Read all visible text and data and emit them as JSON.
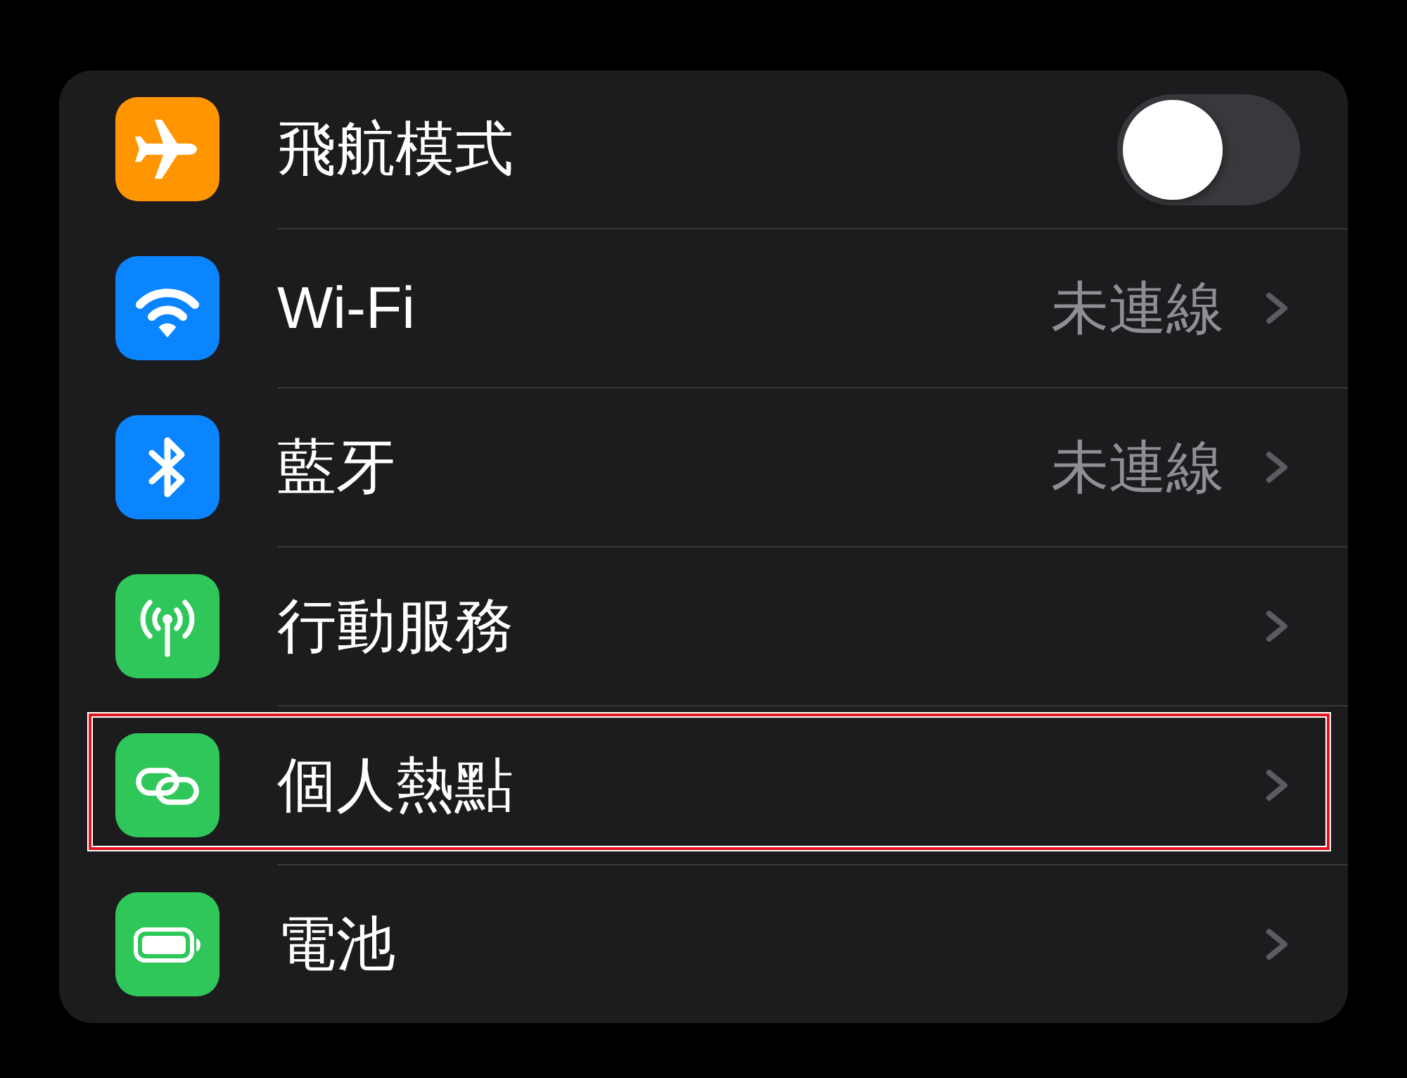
{
  "rows": [
    {
      "label": "飛航模式",
      "kind": "toggle",
      "on": false,
      "color": "#ff9500",
      "highlighted": false
    },
    {
      "label": "Wi-Fi",
      "kind": "link",
      "value": "未連線",
      "color": "#0a84ff",
      "highlighted": false
    },
    {
      "label": "藍牙",
      "kind": "link",
      "value": "未連線",
      "color": "#0a84ff",
      "highlighted": false
    },
    {
      "label": "行動服務",
      "kind": "link",
      "color": "#30c75a",
      "highlighted": false
    },
    {
      "label": "個人熱點",
      "kind": "link",
      "color": "#30c75a",
      "highlighted": true
    },
    {
      "label": "電池",
      "kind": "link",
      "color": "#30c75a",
      "highlighted": false
    }
  ]
}
